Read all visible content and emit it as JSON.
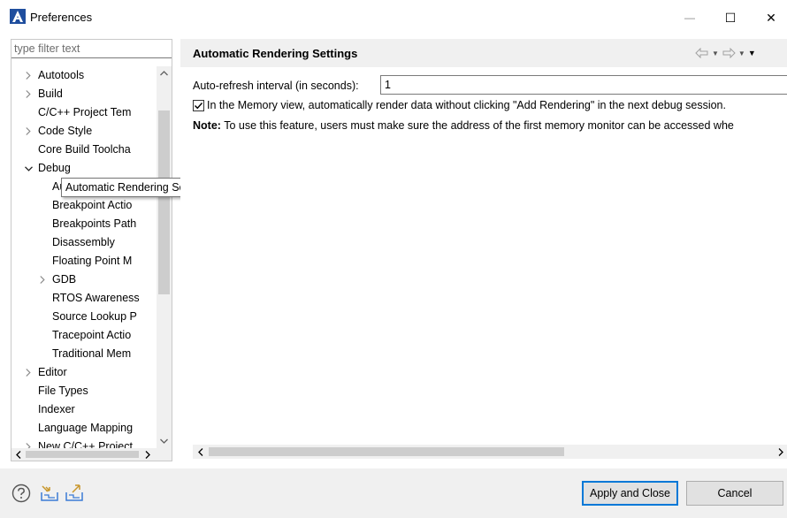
{
  "window": {
    "title": "Preferences",
    "minimize_glyph": "—",
    "maximize_glyph": "☐",
    "close_glyph": "✕"
  },
  "filter": {
    "placeholder": "type filter text",
    "value": ""
  },
  "tree": {
    "items": [
      {
        "label": "Autotools",
        "twisty": "collapsed",
        "indent": 0
      },
      {
        "label": "Build",
        "twisty": "collapsed",
        "indent": 0
      },
      {
        "label": "C/C++ Project Tem",
        "twisty": "none",
        "indent": 0
      },
      {
        "label": "Code Style",
        "twisty": "collapsed",
        "indent": 0
      },
      {
        "label": "Core Build Toolcha",
        "twisty": "none",
        "indent": 0
      },
      {
        "label": "Debug",
        "twisty": "expanded",
        "indent": 0
      },
      {
        "label": "Automatic Rendering Settings",
        "twisty": "none",
        "indent": 1
      },
      {
        "label": "Breakpoint Actio",
        "twisty": "none",
        "indent": 1
      },
      {
        "label": "Breakpoints Path",
        "twisty": "none",
        "indent": 1
      },
      {
        "label": "Disassembly",
        "twisty": "none",
        "indent": 1
      },
      {
        "label": "Floating Point M",
        "twisty": "none",
        "indent": 1
      },
      {
        "label": "GDB",
        "twisty": "collapsed",
        "indent": 1
      },
      {
        "label": "RTOS Awareness",
        "twisty": "none",
        "indent": 1
      },
      {
        "label": "Source Lookup P",
        "twisty": "none",
        "indent": 1
      },
      {
        "label": "Tracepoint Actio",
        "twisty": "none",
        "indent": 1
      },
      {
        "label": "Traditional Mem",
        "twisty": "none",
        "indent": 1
      },
      {
        "label": "Editor",
        "twisty": "collapsed",
        "indent": 0
      },
      {
        "label": "File Types",
        "twisty": "none",
        "indent": 0
      },
      {
        "label": "Indexer",
        "twisty": "none",
        "indent": 0
      },
      {
        "label": "Language Mapping",
        "twisty": "none",
        "indent": 0
      },
      {
        "label": "New C/C++ Project",
        "twisty": "collapsed",
        "indent": 0
      }
    ],
    "tooltip": "Automatic Rendering Settings"
  },
  "page": {
    "title": "Automatic Rendering Settings",
    "refresh_label": "Auto-refresh interval (in seconds):",
    "refresh_value": "1",
    "checkbox_checked": true,
    "checkbox_label": "In the Memory view, automatically render data without clicking \"Add Rendering\" in the next debug session.",
    "note_bold": "Note:",
    "note_text": " To use this feature, users must make sure the address of the first memory monitor can be accessed whe"
  },
  "buttons": {
    "apply_close": "Apply and Close",
    "cancel": "Cancel"
  },
  "icons": {
    "help": "help-icon",
    "import": "import-icon",
    "export": "export-icon",
    "back": "back-arrow-icon",
    "forward": "forward-arrow-icon"
  },
  "colors": {
    "accent": "#0078d7",
    "panel_bg": "#f0f0f0",
    "app_icon_blue": "#1f4e9e"
  }
}
